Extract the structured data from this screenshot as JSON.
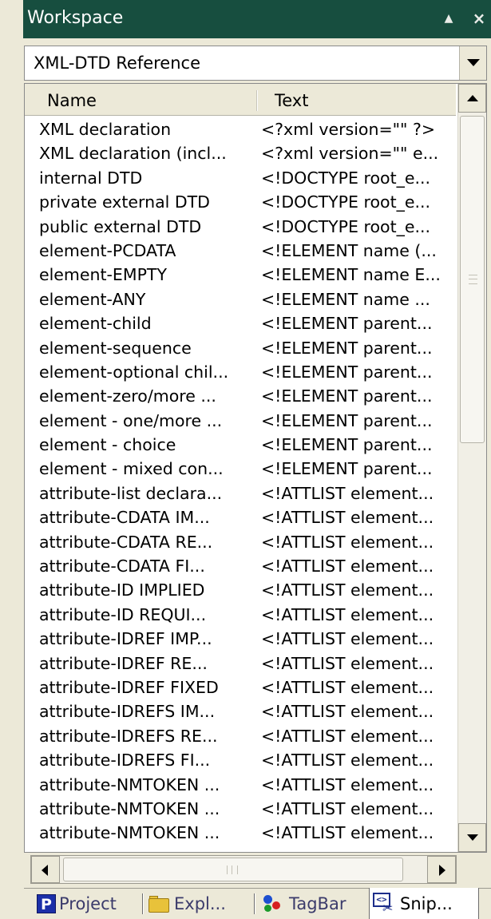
{
  "window": {
    "title": "Workspace",
    "pin_glyph": "▲",
    "close_glyph": "×"
  },
  "dropdown": {
    "selected": "XML-DTD Reference"
  },
  "columns": {
    "name": "Name",
    "text": "Text"
  },
  "rows": [
    {
      "name": "XML declaration",
      "text": "<?xml version=\"\" ?>"
    },
    {
      "name": "XML declaration (incl...",
      "text": "<?xml version=\"\" e..."
    },
    {
      "name": "internal DTD",
      "text": "<!DOCTYPE root_e..."
    },
    {
      "name": "private external DTD",
      "text": "<!DOCTYPE root_e..."
    },
    {
      "name": "public external DTD",
      "text": "<!DOCTYPE root_e..."
    },
    {
      "name": "element-PCDATA",
      "text": "<!ELEMENT name (..."
    },
    {
      "name": "element-EMPTY",
      "text": "<!ELEMENT name E..."
    },
    {
      "name": "element-ANY",
      "text": "<!ELEMENT name ..."
    },
    {
      "name": "element-child",
      "text": "<!ELEMENT parent..."
    },
    {
      "name": "element-sequence",
      "text": "<!ELEMENT parent..."
    },
    {
      "name": "element-optional chil...",
      "text": "<!ELEMENT parent..."
    },
    {
      "name": "element-zero/more ...",
      "text": "<!ELEMENT parent..."
    },
    {
      "name": "element - one/more ...",
      "text": "<!ELEMENT parent..."
    },
    {
      "name": "element - choice",
      "text": "<!ELEMENT parent..."
    },
    {
      "name": "element - mixed con...",
      "text": "<!ELEMENT parent..."
    },
    {
      "name": "attribute-list declara...",
      "text": "<!ATTLIST element..."
    },
    {
      "name": "attribute-CDATA IM...",
      "text": "<!ATTLIST element..."
    },
    {
      "name": "attribute-CDATA RE...",
      "text": "<!ATTLIST element..."
    },
    {
      "name": "attribute-CDATA FI...",
      "text": "<!ATTLIST element..."
    },
    {
      "name": "attribute-ID IMPLIED",
      "text": "<!ATTLIST element..."
    },
    {
      "name": "attribute-ID REQUI...",
      "text": "<!ATTLIST element..."
    },
    {
      "name": "attribute-IDREF IMP...",
      "text": "<!ATTLIST element..."
    },
    {
      "name": "attribute-IDREF RE...",
      "text": "<!ATTLIST element..."
    },
    {
      "name": "attribute-IDREF FIXED",
      "text": "<!ATTLIST element..."
    },
    {
      "name": "attribute-IDREFS IM...",
      "text": "<!ATTLIST element..."
    },
    {
      "name": "attribute-IDREFS RE...",
      "text": "<!ATTLIST element..."
    },
    {
      "name": "attribute-IDREFS FI...",
      "text": "<!ATTLIST element..."
    },
    {
      "name": "attribute-NMTOKEN ...",
      "text": "<!ATTLIST element..."
    },
    {
      "name": "attribute-NMTOKEN ...",
      "text": "<!ATTLIST element..."
    },
    {
      "name": "attribute-NMTOKEN ...",
      "text": "<!ATTLIST element..."
    }
  ],
  "tabs": [
    {
      "label": "Project",
      "icon": "project-icon",
      "active": false
    },
    {
      "label": "Expl...",
      "icon": "folder-icon",
      "active": false
    },
    {
      "label": "TagBar",
      "icon": "tagbar-icon",
      "active": false
    },
    {
      "label": "Snip...",
      "icon": "snippets-icon",
      "active": true
    }
  ],
  "colors": {
    "titlebar": "#174e3f",
    "panel_bg": "#ece9d8",
    "list_bg": "#ffffff",
    "tab_text": "#3b3b6b"
  }
}
